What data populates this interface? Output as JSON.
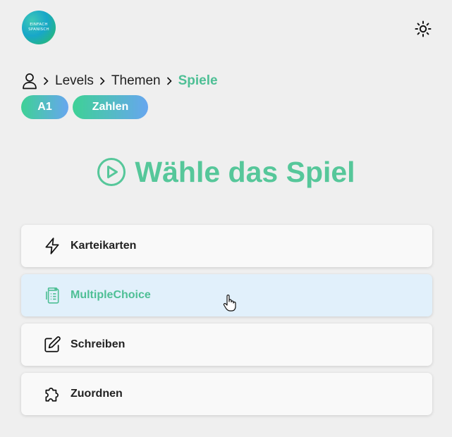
{
  "logo": {
    "line1": "EINFACH",
    "line2": "SPANISCH"
  },
  "header": {
    "theme_icon": "sun-icon"
  },
  "breadcrumb": {
    "home_icon": "user-icon",
    "items": [
      "Levels",
      "Themen",
      "Spiele"
    ]
  },
  "tags": {
    "level": "A1",
    "topic": "Zahlen"
  },
  "heading": {
    "icon": "play-circle-icon",
    "title": "Wähle das Spiel"
  },
  "games": [
    {
      "label": "Karteikarten",
      "icon": "lightning-icon"
    },
    {
      "label": "MultipleChoice",
      "icon": "clipboard-list-icon"
    },
    {
      "label": "Schreiben",
      "icon": "pencil-square-icon"
    },
    {
      "label": "Zuordnen",
      "icon": "puzzle-icon"
    }
  ],
  "colors": {
    "accent": "#4ebf95",
    "hover_bg": "#e1f0fb",
    "background": "#efefef"
  }
}
